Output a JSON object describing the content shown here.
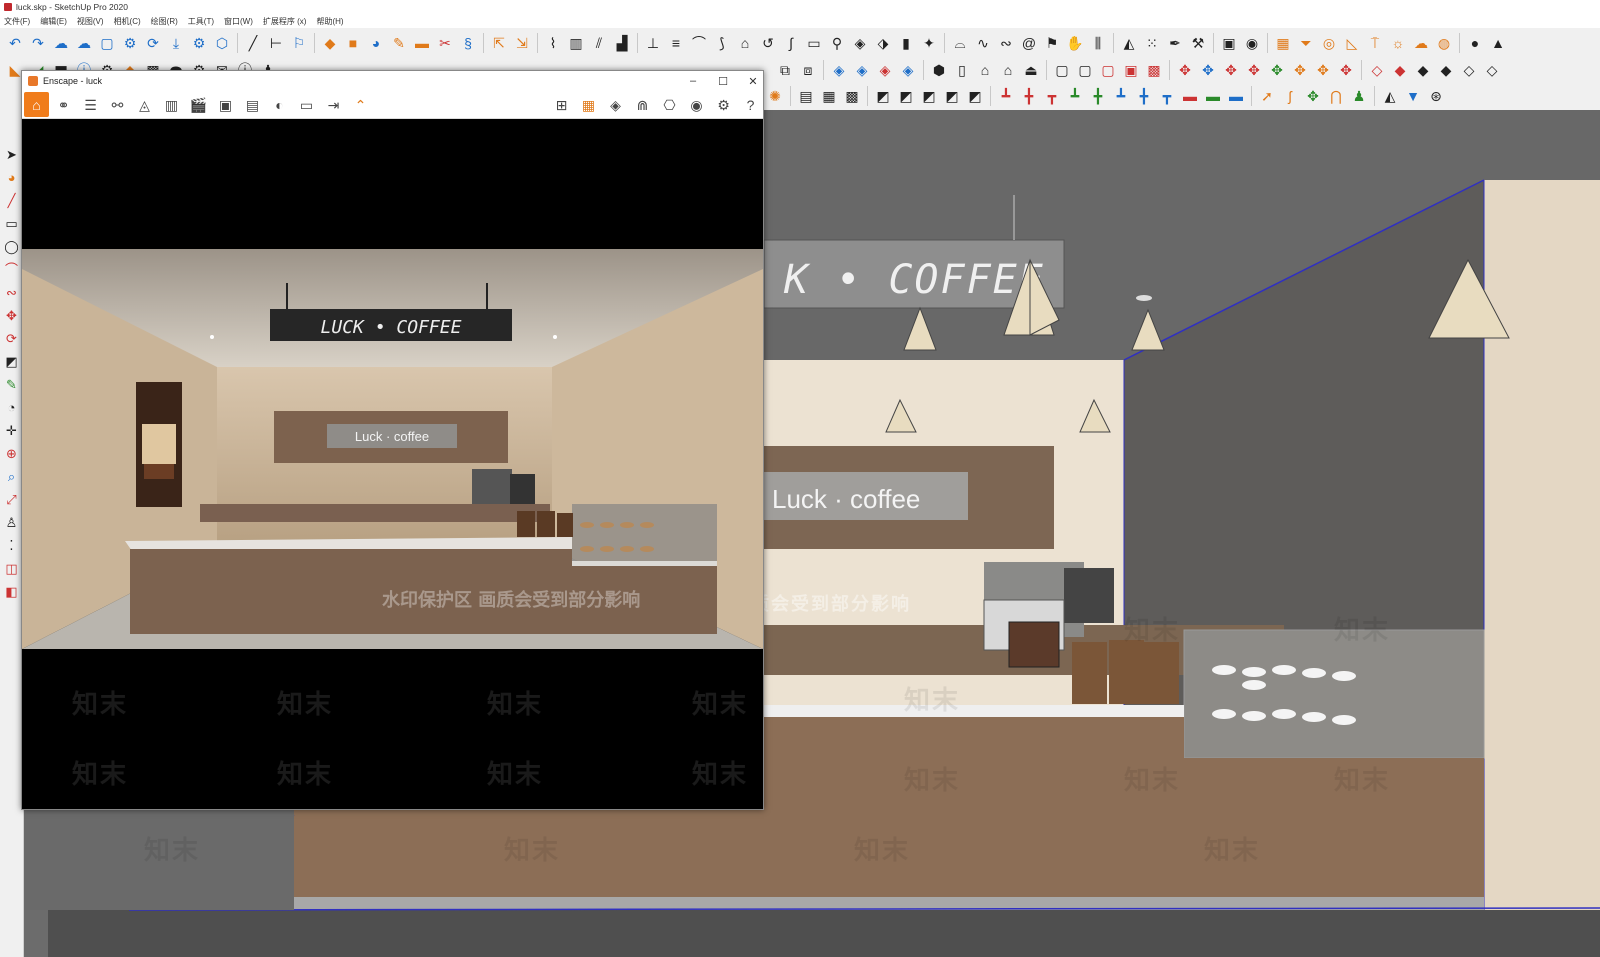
{
  "window": {
    "title": "luck.skp - SketchUp Pro 2020"
  },
  "menu": [
    "文件(F)",
    "编辑(E)",
    "视图(V)",
    "相机(C)",
    "绘图(R)",
    "工具(T)",
    "窗口(W)",
    "扩展程序 (x)",
    "帮助(H)"
  ],
  "enscape": {
    "title": "Enscape - luck",
    "toolbar_icons": [
      "home-icon",
      "link-icon",
      "bim-icon",
      "binoculars-icon",
      "perspective-icon",
      "building-icon",
      "clapper-icon",
      "screenshot-icon",
      "batch-render-icon",
      "panorama-icon",
      "web-export-icon",
      "exe-export-icon",
      "collapse-icon",
      "map-icon",
      "asset-library-icon",
      "cube-view-icon",
      "material-icon",
      "vr-icon",
      "visual-settings-icon",
      "settings-icon",
      "help-icon"
    ],
    "render_signs": {
      "hanging": "LUCK • COFFEE",
      "wall": "Luck · coffee"
    }
  },
  "model_signs": {
    "hanging": "K • COFFEE",
    "wall": "Luck · coffee"
  },
  "watermark": {
    "brand": "知末",
    "notice": "水印保护区   画质会受到部分影响"
  },
  "colors": {
    "accent": "#f07c1b",
    "wall": "#e8dccb",
    "wood": "#8a6a52",
    "ceiling": "#6b6b6b"
  }
}
